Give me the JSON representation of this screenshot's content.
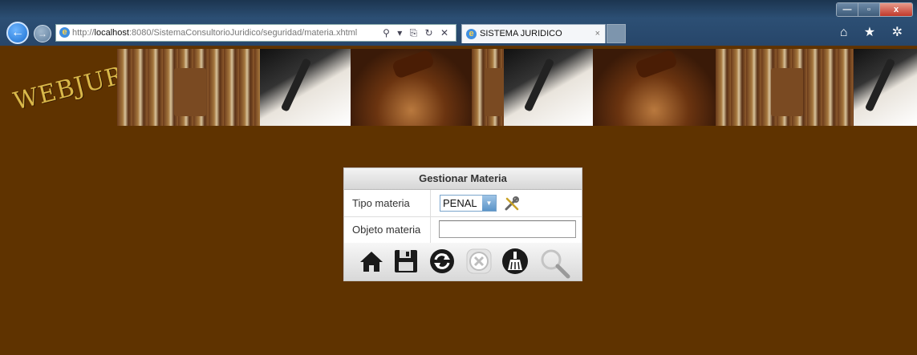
{
  "browser": {
    "url_prefix": "http://",
    "url_host": "localhost",
    "url_rest": ":8080/SistemaConsultorioJuridico/seguridad/materia.xhtml",
    "url_tools": "⚲ ▾ ⎘ ↻ ✕",
    "tab_title": "SISTEMA JURIDICO",
    "tab_close": "×",
    "right_icons": "⌂ ★ ✲",
    "window_buttons": {
      "minimize": "—",
      "maximize": "▫",
      "close": "x"
    }
  },
  "banner": {
    "logo": "WEBJURIS"
  },
  "panel": {
    "title": "Gestionar Materia",
    "tipo_label": "Tipo materia",
    "tipo_value": "PENAL",
    "objeto_label": "Objeto materia",
    "objeto_value": ""
  },
  "toolbar": {
    "icons": [
      "home-icon",
      "save-icon",
      "refresh-icon",
      "delete-icon",
      "clear-icon",
      "search-icon"
    ]
  },
  "colors": {
    "page_bg": "#5f3300",
    "accent": "#5b94c8"
  }
}
